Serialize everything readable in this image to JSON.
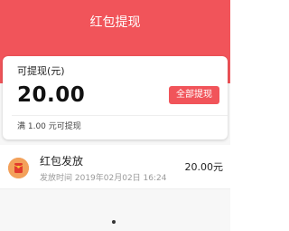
{
  "header": {
    "title": "红包提现"
  },
  "balance": {
    "label": "可提现(元)",
    "amount": "20.00",
    "withdraw_button": "全部提现",
    "min_note": "满 1.00 元可提现"
  },
  "records": [
    {
      "icon": "red-envelope-icon",
      "title": "红包发放",
      "time": "发放时间 2019年02月02日 16:24",
      "amount": "20.00元"
    }
  ],
  "colors": {
    "accent": "#f1545a",
    "icon": "#f3a15b"
  }
}
